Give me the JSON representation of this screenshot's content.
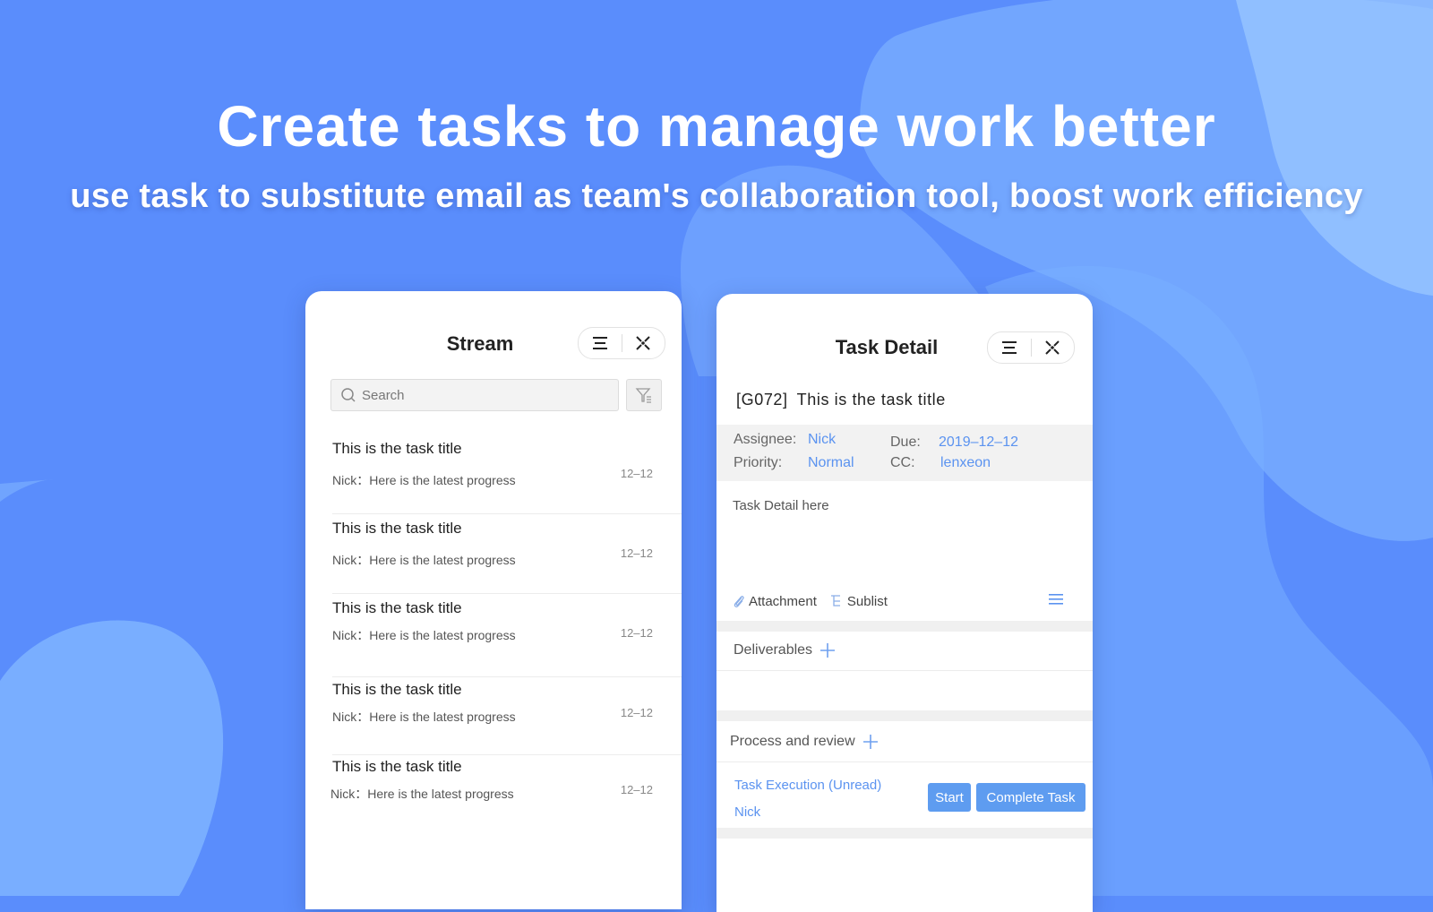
{
  "headline": "Create tasks to manage work better",
  "subheadline": "use task to substitute email as team's collaboration tool, boost work efficiency",
  "colors": {
    "background": "#5a8dfc",
    "accent": "#5b93f0",
    "button": "#5e9cf0"
  },
  "stream": {
    "title": "Stream",
    "search_placeholder": "Search",
    "items": [
      {
        "title": "This is the task title",
        "subtitle": "Nick：Here is the latest progress",
        "date": "12–12"
      },
      {
        "title": "This is the task title",
        "subtitle": "Nick：Here is the latest progress",
        "date": "12–12"
      },
      {
        "title": "This is the task title",
        "subtitle": "Nick：Here is the latest progress",
        "date": "12–12"
      },
      {
        "title": "This is the task title",
        "subtitle": "Nick：Here is the latest progress",
        "date": "12–12"
      },
      {
        "title": "This is the task title",
        "subtitle": "Nick：Here is the latest progress",
        "date": "12–12"
      }
    ]
  },
  "detail": {
    "title": "Task Detail",
    "task_code": "[G072]",
    "task_title": "This is the task title",
    "assignee_label": "Assignee:",
    "assignee_value": "Nick",
    "due_label": "Due:",
    "due_value": "2019–12–12",
    "priority_label": "Priority:",
    "priority_value": "Normal",
    "cc_label": "CC:",
    "cc_value": "lenxeon",
    "description": "Task Detail here",
    "attachment_label": "Attachment",
    "sublist_label": "Sublist",
    "deliverables_label": "Deliverables",
    "process_label": "Process and review",
    "process_item_name": "Task Execution (Unread)",
    "process_item_user": "Nick",
    "start_label": "Start",
    "complete_label": "Complete Task"
  }
}
